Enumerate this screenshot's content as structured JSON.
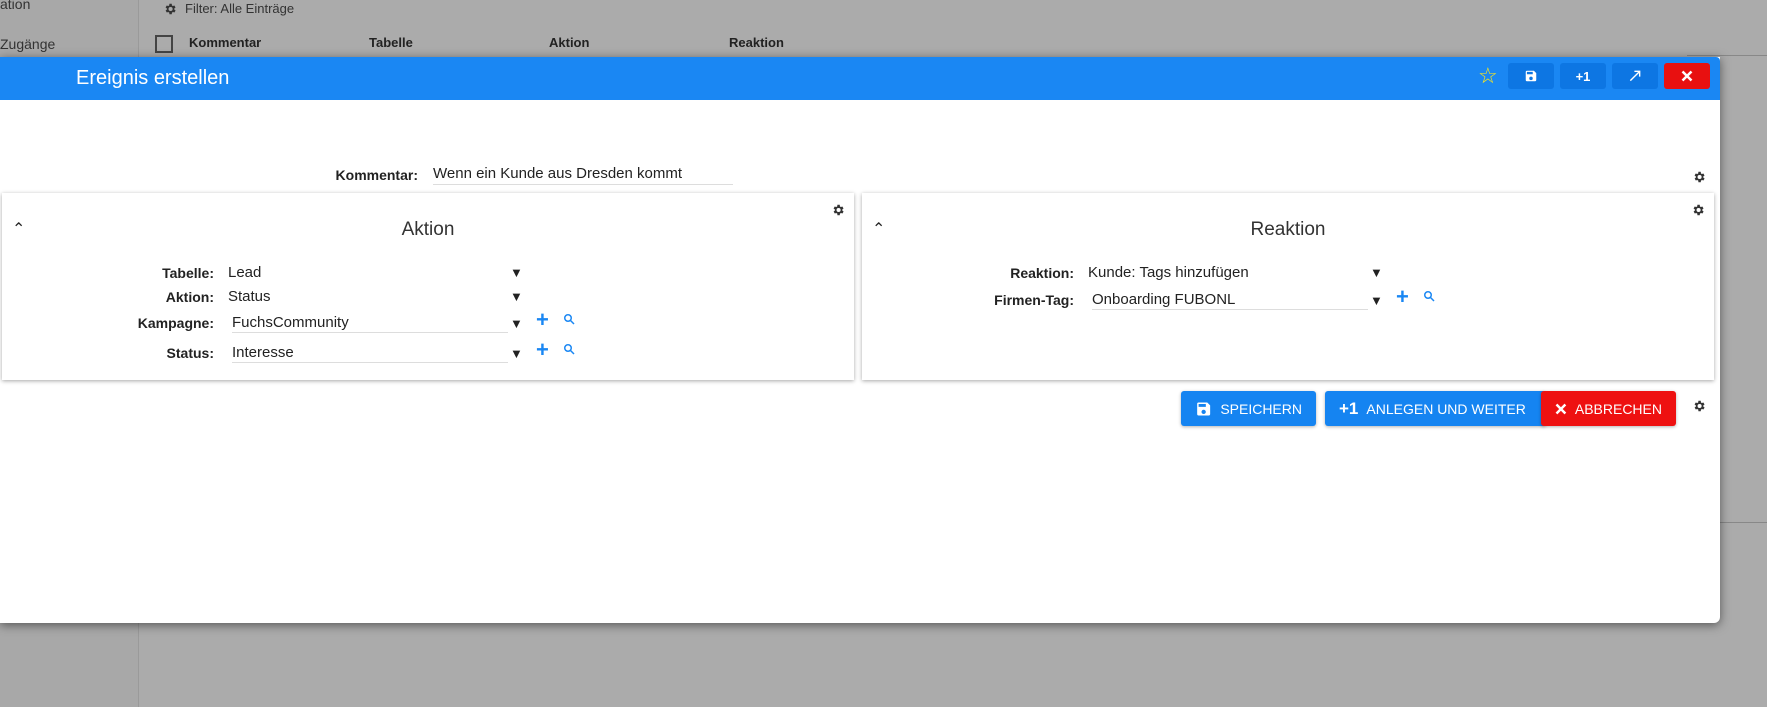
{
  "background": {
    "sidebar": [
      {
        "label": "ation"
      },
      {
        "label": "Zugänge"
      }
    ],
    "filter": "Filter: Alle Einträge",
    "columns": [
      "Kommentar",
      "Tabelle",
      "Aktion",
      "Reaktion"
    ]
  },
  "dialog": {
    "title": "Ereignis erstellen",
    "toolbar": {
      "plus_one": "+1"
    },
    "comment": {
      "label": "Kommentar:",
      "value": "Wenn ein Kunde aus Dresden kommt"
    },
    "aktion_panel": {
      "title": "Aktion",
      "fields": [
        {
          "label": "Tabelle:",
          "value": "Lead"
        },
        {
          "label": "Aktion:",
          "value": "Status"
        },
        {
          "label": "Kampagne:",
          "value": "FuchsCommunity"
        },
        {
          "label": "Status:",
          "value": "Interesse"
        }
      ]
    },
    "reaktion_panel": {
      "title": "Reaktion",
      "fields": [
        {
          "label": "Reaktion:",
          "value": "Kunde: Tags hinzufügen"
        },
        {
          "label": "Firmen-Tag:",
          "value": "Onboarding FUBONL"
        }
      ]
    },
    "buttons": {
      "save": "SPEICHERN",
      "save_next": "ANLEGEN UND WEITER",
      "cancel": "ABBRECHEN",
      "plus_one": "+1"
    }
  },
  "colors": {
    "accent": "#1a87f3",
    "danger": "#e81010",
    "star": "#ffe81a"
  }
}
